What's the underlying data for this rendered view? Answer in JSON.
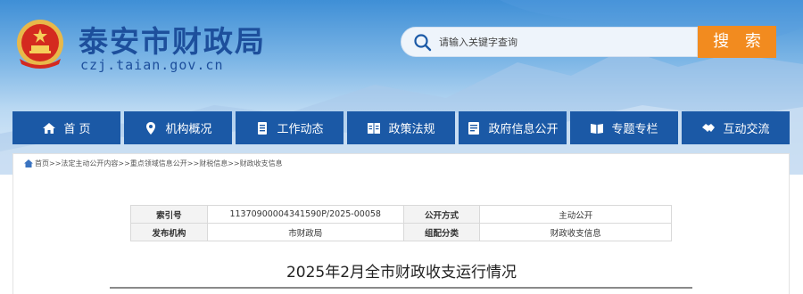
{
  "header": {
    "site_title": "泰安市财政局",
    "site_domain": "czj.taian.gov.cn",
    "logo_icon": "national-emblem-icon"
  },
  "search": {
    "placeholder": "请输入关键字查询",
    "button_label": "搜 索"
  },
  "nav": {
    "items": [
      {
        "label": "首 页",
        "icon": "home-icon"
      },
      {
        "label": "机构概况",
        "icon": "location-pin-icon"
      },
      {
        "label": "工作动态",
        "icon": "document-icon"
      },
      {
        "label": "政策法规",
        "icon": "book-icon"
      },
      {
        "label": "政府信息公开",
        "icon": "list-icon"
      },
      {
        "label": "专题专栏",
        "icon": "open-book-icon"
      },
      {
        "label": "互动交流",
        "icon": "handshake-icon"
      }
    ]
  },
  "breadcrumb": "首页>>法定主动公开内容>>重点领域信息公开>>财税信息>>财政收支信息",
  "meta": {
    "index_label": "索引号",
    "index_value": "11370900004341590P/2025-00058",
    "disclosure_label": "公开方式",
    "disclosure_value": "主动公开",
    "publisher_label": "发布机构",
    "publisher_value": "市财政局",
    "category_label": "组配分类",
    "category_value": "财政收支信息"
  },
  "article": {
    "title": "2025年2月全市财政收支运行情况"
  },
  "colors": {
    "nav_bg": "#1b59a6",
    "search_button": "#f28b1f",
    "title_blue": "#1d4f9c"
  }
}
